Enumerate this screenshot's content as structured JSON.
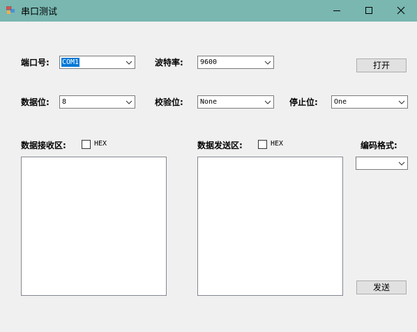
{
  "window": {
    "title": "串口测试"
  },
  "labels": {
    "port": "端口号:",
    "baud": "波特率:",
    "databits": "数据位:",
    "parity": "校验位:",
    "stopbits": "停止位:",
    "receive": "数据接收区:",
    "send": "数据发送区:",
    "encoding": "编码格式:"
  },
  "combos": {
    "port": "COM1",
    "baud": "9600",
    "databits": "8",
    "parity": "None",
    "stopbits": "One",
    "encoding": ""
  },
  "checkboxes": {
    "receive_hex": "HEX",
    "send_hex": "HEX"
  },
  "buttons": {
    "open": "打开",
    "send": "发送"
  },
  "textareas": {
    "receive": "",
    "send": ""
  }
}
